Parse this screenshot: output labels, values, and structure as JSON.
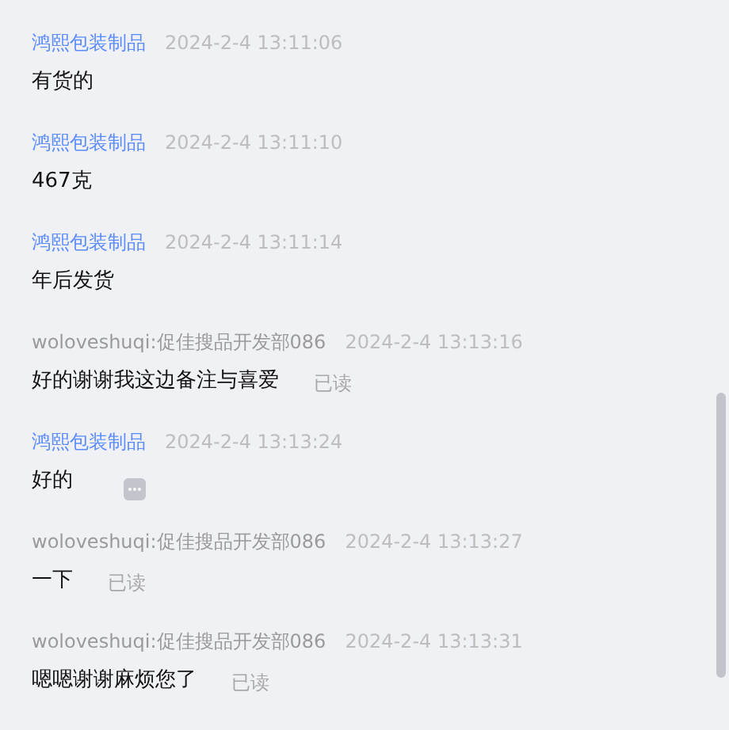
{
  "messages": [
    {
      "sender": "鸿熙包装制品",
      "kind": "seller",
      "time": "2024-2-4 13:11:06",
      "text": "有货的",
      "menu": false
    },
    {
      "sender": "鸿熙包装制品",
      "kind": "seller",
      "time": "2024-2-4 13:11:10",
      "text": "467克",
      "menu": false
    },
    {
      "sender": "鸿熙包装制品",
      "kind": "seller",
      "time": "2024-2-4 13:11:14",
      "text": "年后发货",
      "menu": false
    },
    {
      "sender": "woloveshuqi:促佳搜品开发部086",
      "kind": "buyer",
      "time": "2024-2-4 13:13:16",
      "text": "好的谢谢我这边备注与喜爱",
      "read_receipt": "已读",
      "menu": false
    },
    {
      "sender": "鸿熙包装制品",
      "kind": "seller",
      "time": "2024-2-4 13:13:24",
      "text": "好的",
      "menu": true
    },
    {
      "sender": "woloveshuqi:促佳搜品开发部086",
      "kind": "buyer",
      "time": "2024-2-4 13:13:27",
      "text": "一下",
      "read_receipt": "已读",
      "menu": false
    },
    {
      "sender": "woloveshuqi:促佳搜品开发部086",
      "kind": "buyer",
      "time": "2024-2-4 13:13:31",
      "text": "嗯嗯谢谢麻烦您了",
      "read_receipt": "已读",
      "menu": false
    }
  ]
}
